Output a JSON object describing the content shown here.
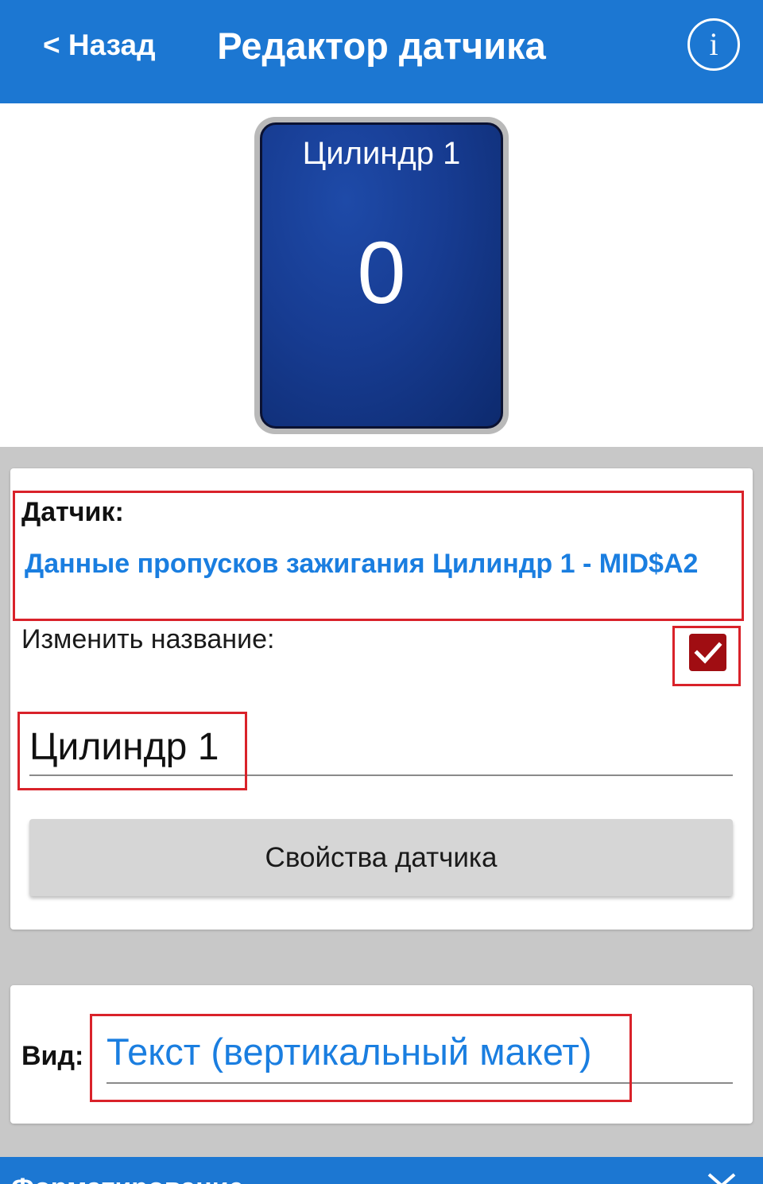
{
  "header": {
    "back_label": "< Назад",
    "title": "Редактор датчика",
    "info_icon": "info-icon"
  },
  "preview": {
    "tile_name": "Цилиндр 1",
    "tile_value": "0"
  },
  "sensor_card": {
    "sensor_label": "Датчик:",
    "sensor_value": "Данные пропусков зажигания Цилиндр 1 - MID$A2",
    "rename_label": "Изменить название:",
    "rename_checked": true,
    "name_value": "Цилиндр 1",
    "properties_button": "Свойства датчика"
  },
  "view_card": {
    "view_label": "Вид:",
    "view_value": "Текст (вертикальный макет)"
  },
  "bottom_section": {
    "title": "Форматирование",
    "chevron_icon": "chevron-icon"
  },
  "colors": {
    "accent": "#1c77d2",
    "link": "#1a7ee0",
    "checkbox": "#a00d12",
    "highlight_box": "#d9222a",
    "tile": "#173c92"
  }
}
